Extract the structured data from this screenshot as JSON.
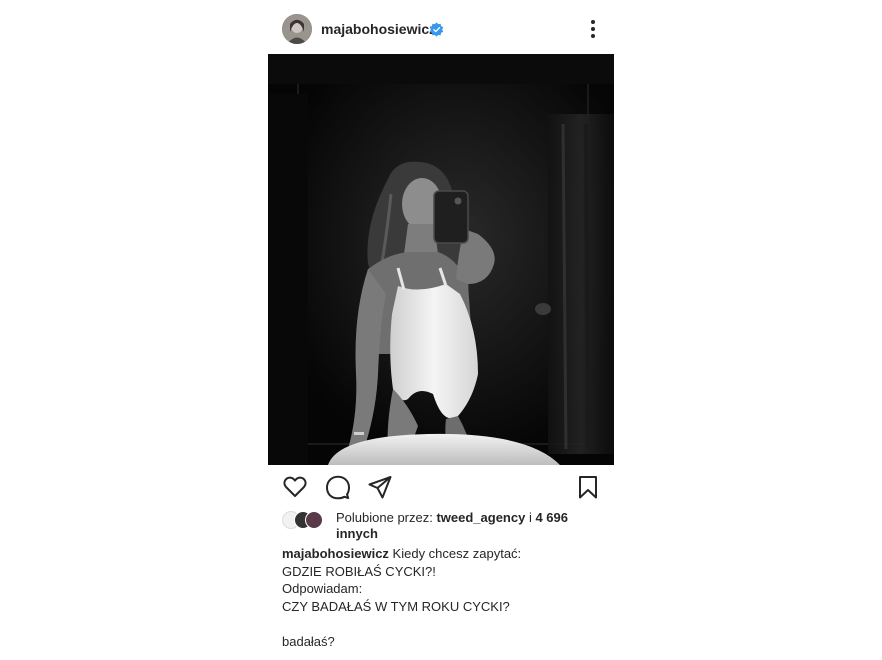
{
  "post": {
    "username": "majabohosiewicz",
    "verified": true,
    "accent_color": "#3897f0",
    "photo": {
      "style": "black-and-white mirror selfie",
      "tones": [
        "#050505",
        "#1c1c1c",
        "#e8e8e8"
      ]
    },
    "actions": {
      "like_icon": "heart-icon",
      "comment_icon": "comment-icon",
      "share_icon": "paper-plane-icon",
      "save_icon": "bookmark-icon"
    },
    "likes": {
      "prefix": "Polubione przez: ",
      "user": "tweed_agency",
      "middle": " i ",
      "count": "4 696",
      "suffix": "innych"
    },
    "caption": {
      "first_line": "Kiedy chcesz zapytać:",
      "lines": [
        "GDZIE ROBIŁAŚ CYCKI?!",
        "Odpowiadam:",
        "CZY BADAŁAŚ W TYM ROKU CYCKI?",
        "",
        "badałaś?"
      ]
    }
  }
}
